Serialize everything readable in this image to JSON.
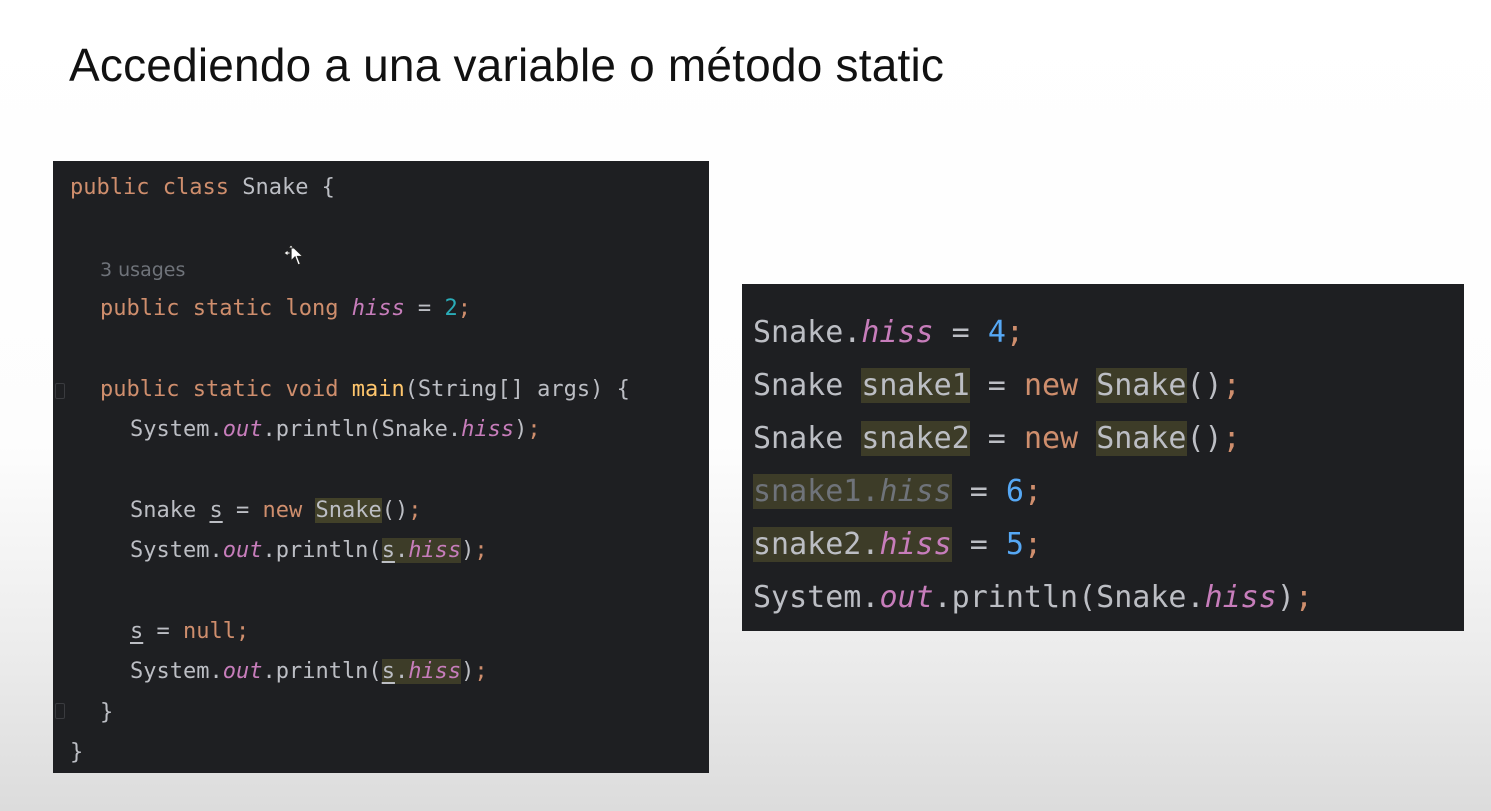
{
  "slide": {
    "title": "Accediendo a una variable o método static"
  },
  "left_code": {
    "l1_public": "public",
    "l1_class": "class",
    "l1_rest": " Snake {",
    "usages": "3 usages",
    "l3_public": "public",
    "l3_static": "static",
    "l3_long": "long",
    "l3_hiss": "hiss",
    "l3_eq": " = ",
    "l3_num": "2",
    "l3_semi": ";",
    "l4_public": "public",
    "l4_static": "static",
    "l4_void": "void",
    "l4_main": "main",
    "l4_rest": "(String[] args) {",
    "l5_a": "System.",
    "l5_out": "out",
    "l5_b": ".println(Snake.",
    "l5_hiss": "hiss",
    "l5_c": ")",
    "l5_semi": ";",
    "l6_a": "Snake ",
    "l6_s": "s",
    "l6_eq": " = ",
    "l6_new": "new",
    "l6_snake": "Snake",
    "l6_paren": "()",
    "l6_semi": ";",
    "l7_a": "System.",
    "l7_out": "out",
    "l7_b": ".println(",
    "l7_s": "s",
    "l7_dot": ".",
    "l7_hiss": "hiss",
    "l7_c": ")",
    "l7_semi": ";",
    "l8_s": "s",
    "l8_eq": " = ",
    "l8_null": "null",
    "l8_semi": ";",
    "l9_a": "System.",
    "l9_out": "out",
    "l9_b": ".println(",
    "l9_s": "s",
    "l9_dot": ".",
    "l9_hiss": "hiss",
    "l9_c": ")",
    "l9_semi": ";",
    "close_method": "}",
    "close_class": "}"
  },
  "right_code": {
    "r1_a": "Snake.",
    "r1_hiss": "hiss",
    "r1_eq": " = ",
    "r1_num": "4",
    "r1_semi": ";",
    "r2_a": "Snake ",
    "r2_var": "snake1",
    "r2_eq": " = ",
    "r2_new": "new",
    "r2_sp": " ",
    "r2_snake": "Snake",
    "r2_paren": "()",
    "r2_semi": ";",
    "r3_a": "Snake ",
    "r3_var": "snake2",
    "r3_eq": " = ",
    "r3_new": "new",
    "r3_sp": " ",
    "r3_snake": "Snake",
    "r3_paren": "()",
    "r3_semi": ";",
    "r4_var": "snake1.",
    "r4_hiss": "hiss",
    "r4_eq": " = ",
    "r4_num": "6",
    "r4_semi": ";",
    "r5_var": "snake2.",
    "r5_hiss": "hiss",
    "r5_eq": " = ",
    "r5_num": "5",
    "r5_semi": ";",
    "r6_a": "System.",
    "r6_out": "out",
    "r6_b": ".println(Snake.",
    "r6_hiss": "hiss",
    "r6_c": ")",
    "r6_semi": ";"
  },
  "icons": {
    "cursor": "move-cursor-icon"
  },
  "colors": {
    "code_background": "#1e1f22",
    "keyword": "#cf8e6d",
    "static_field": "#c77dbb",
    "number": "#2aacb8",
    "default_text": "#bcbec4"
  }
}
